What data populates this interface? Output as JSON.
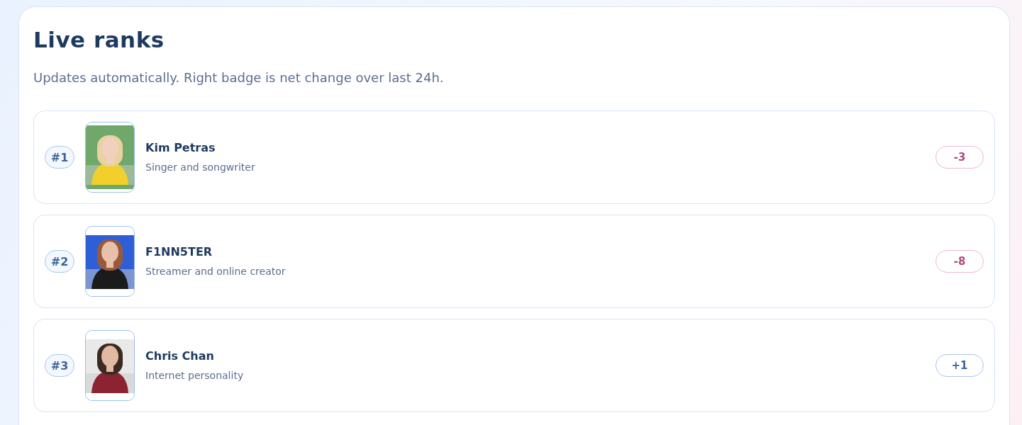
{
  "title": "Live ranks",
  "subtitle": "Updates automatically. Right badge is net change over last 24h.",
  "ranks": [
    {
      "rank": "#1",
      "name": "Kim Petras",
      "description": "Singer and songwriter",
      "change": "-3",
      "kind": "down"
    },
    {
      "rank": "#2",
      "name": "F1NN5TER",
      "description": "Streamer and online creator",
      "change": "-8",
      "kind": "down"
    },
    {
      "rank": "#3",
      "name": "Chris Chan",
      "description": "Internet personality",
      "change": "+1",
      "kind": "up"
    }
  ]
}
